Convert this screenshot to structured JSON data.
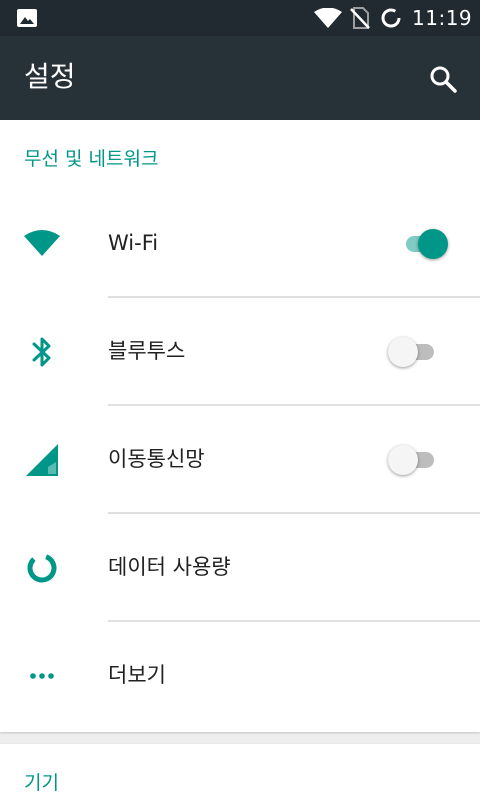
{
  "status_bar": {
    "time": "11:19",
    "icons": [
      "image-icon",
      "wifi-signal-icon",
      "no-sim-icon",
      "sync-ring-icon"
    ]
  },
  "app_bar": {
    "title": "설정",
    "search_icon": "search-icon"
  },
  "sections": [
    {
      "header": "무선 및 네트워크",
      "items": [
        {
          "label": "Wi-Fi",
          "icon": "wifi-icon",
          "toggle": "on"
        },
        {
          "label": "블루투스",
          "icon": "bluetooth-icon",
          "toggle": "off"
        },
        {
          "label": "이동통신망",
          "icon": "cellular-signal-icon",
          "toggle": "off"
        },
        {
          "label": "데이터 사용량",
          "icon": "data-usage-icon"
        },
        {
          "label": "더보기",
          "icon": "more-horiz-icon"
        }
      ]
    },
    {
      "header": "기기",
      "items": []
    }
  ],
  "colors": {
    "accent": "#009688",
    "accent_light": "#80cbc4",
    "app_bar": "#263238",
    "status_bar": "#202a30"
  }
}
